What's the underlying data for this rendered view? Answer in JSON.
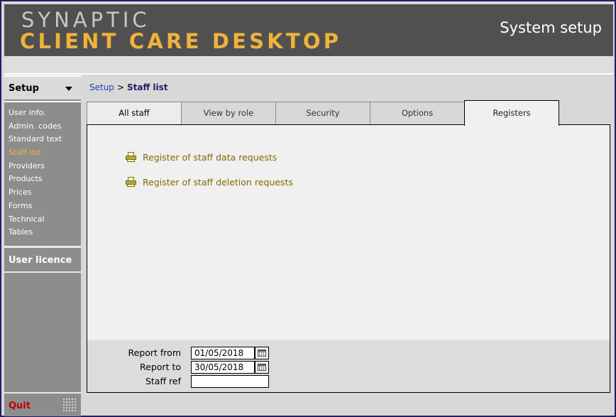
{
  "header": {
    "logo_top": "SYNAPTIC",
    "logo_bottom": "CLIENT CARE DESKTOP",
    "title": "System setup"
  },
  "colors": {
    "header_bg": "#505050",
    "logo_accent": "#f0b23a",
    "active_menu": "#f0b23a",
    "link": "#1a3fc4",
    "register_link": "#7a6d00",
    "quit": "#c00000"
  },
  "sidebar": {
    "section_title": "Setup",
    "items": [
      {
        "label": "User info.",
        "active": false
      },
      {
        "label": "Admin. codes",
        "active": false
      },
      {
        "label": "Standard text",
        "active": false
      },
      {
        "label": "Staff list",
        "active": true
      },
      {
        "label": "Providers",
        "active": false
      },
      {
        "label": "Products",
        "active": false
      },
      {
        "label": "Prices",
        "active": false
      },
      {
        "label": "Forms",
        "active": false
      },
      {
        "label": "Technical",
        "active": false
      },
      {
        "label": "Tables",
        "active": false
      }
    ],
    "licence_label": "User licence",
    "quit_label": "Quit"
  },
  "breadcrumb": {
    "parent": "Setup",
    "separator": ">",
    "current": "Staff list"
  },
  "tabs": [
    {
      "label": "All staff"
    },
    {
      "label": "View by role"
    },
    {
      "label": "Security"
    },
    {
      "label": "Options"
    },
    {
      "label": "Registers",
      "active": true
    }
  ],
  "registers": {
    "data_requests": "Register of staff data requests",
    "deletion_requests": "Register of staff deletion requests",
    "icon": "printer-icon"
  },
  "form": {
    "report_from_label": "Report from",
    "report_from_value": "01/05/2018",
    "report_to_label": "Report to",
    "report_to_value": "30/05/2018",
    "staff_ref_label": "Staff ref",
    "staff_ref_value": ""
  }
}
